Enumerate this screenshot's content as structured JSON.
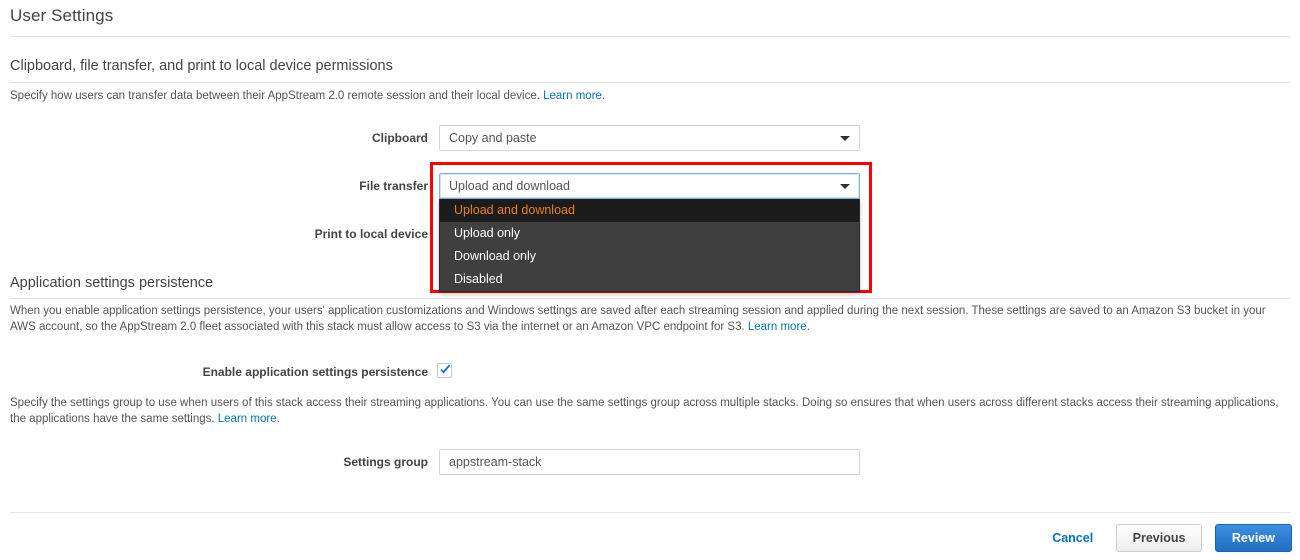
{
  "page_title": "User Settings",
  "sections": {
    "permissions": {
      "title": "Clipboard, file transfer, and print to local device permissions",
      "description_prefix": "Specify how users can transfer data between their AppStream 2.0 remote session and their local device. ",
      "description_link": "Learn more",
      "description_suffix": ".",
      "fields": {
        "clipboard": {
          "label": "Clipboard",
          "value": "Copy and paste"
        },
        "file_transfer": {
          "label": "File transfer",
          "value": "Upload and download"
        },
        "print_to_local_device": {
          "label": "Print to local device",
          "value": ""
        }
      }
    },
    "persistence": {
      "title": "Application settings persistence",
      "description_prefix": "When you enable application settings persistence, your users' application customizations and Windows settings are saved after each streaming session and applied during the next session. These settings are saved to an Amazon S3 bucket in your AWS account, so the AppStream 2.0 fleet associated with this stack must allow access to S3 via the internet or an Amazon VPC endpoint for S3. ",
      "description_link": "Learn more",
      "description_suffix": ".",
      "enable_label": "Enable application settings persistence",
      "enable_checked": true,
      "settings_group_description_prefix": "Specify the settings group to use when users of this stack access their streaming applications. You can use the same settings group across multiple stacks. Doing so ensures that when users across different stacks access their streaming applications, the applications have the same settings. ",
      "settings_group_description_link": "Learn more",
      "settings_group_description_suffix": ".",
      "settings_group": {
        "label": "Settings group",
        "value": "appstream-stack"
      }
    }
  },
  "dropdown": {
    "open": true,
    "selected": "Upload and download",
    "options": [
      "Upload and download",
      "Upload only",
      "Download only",
      "Disabled"
    ],
    "highlight_color": "#ff0000",
    "item_bg": "#3f3f3f",
    "selected_bg": "#1c1c1c",
    "selected_text_color": "#f07c1f"
  },
  "footer": {
    "cancel": "Cancel",
    "previous": "Previous",
    "review": "Review",
    "primary_color": "#2d7fd3",
    "link_color": "#0073bb"
  }
}
